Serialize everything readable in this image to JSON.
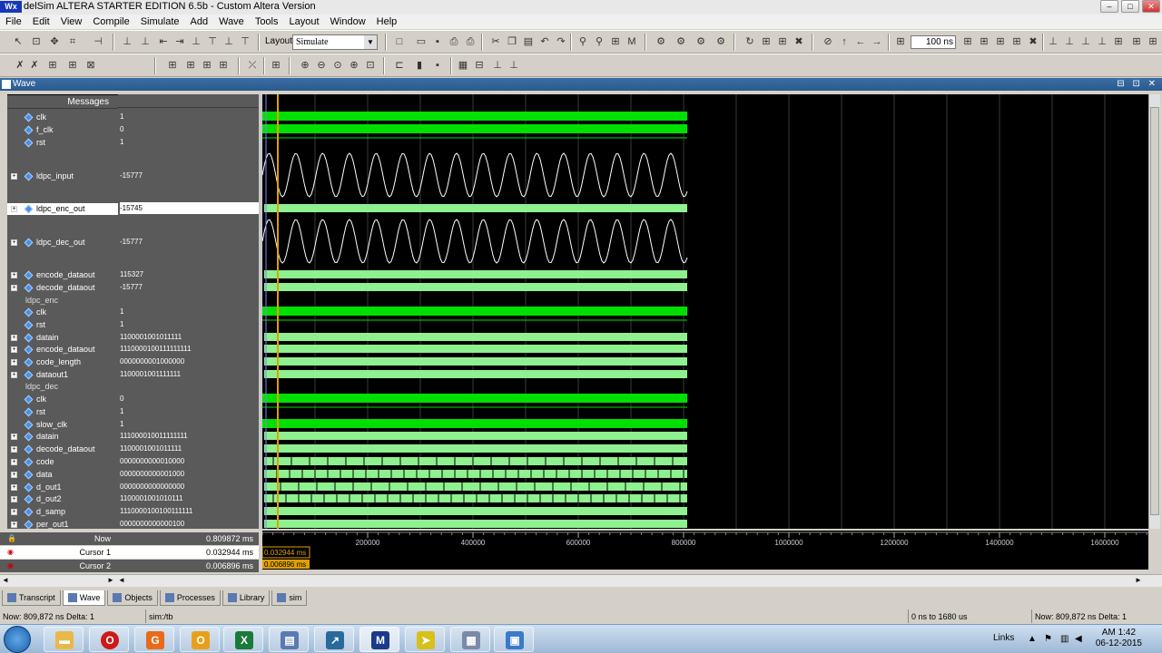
{
  "window": {
    "logo_text": "Wx",
    "title": "delSim ALTERA STARTER EDITION 6.5b - Custom Altera Version",
    "buttons": [
      "–",
      "□",
      "✕"
    ]
  },
  "menu": [
    "File",
    "Edit",
    "View",
    "Compile",
    "Simulate",
    "Add",
    "Wave",
    "Tools",
    "Layout",
    "Window",
    "Help"
  ],
  "toolbar": {
    "layout_label": "Layout",
    "layout_value": "Simulate",
    "run_length": "100 ns"
  },
  "wave_window": {
    "title": "Wave",
    "messages_header": "Messages"
  },
  "signals": [
    {
      "name": "clk",
      "value": "1",
      "expand": false,
      "type": "clock"
    },
    {
      "name": "f_clk",
      "value": "0",
      "expand": false,
      "type": "clock"
    },
    {
      "name": "rst",
      "value": "1",
      "expand": false,
      "type": "high"
    },
    {
      "name": "ldpc_input",
      "value": "-15777",
      "expand": true,
      "type": "sine"
    },
    {
      "name": "ldpc_enc_out",
      "value": "-15745",
      "expand": true,
      "type": "bus",
      "selected": true
    },
    {
      "name": "ldpc_dec_out",
      "value": "-15777",
      "expand": true,
      "type": "sine"
    },
    {
      "name": "encode_dataout",
      "value": "115327",
      "expand": true,
      "type": "bus"
    },
    {
      "name": "decode_dataout",
      "value": "-15777",
      "expand": true,
      "type": "bus"
    },
    {
      "name": "ldpc_enc",
      "value": "",
      "expand": false,
      "type": "group"
    },
    {
      "name": "clk",
      "value": "1",
      "expand": false,
      "type": "clock"
    },
    {
      "name": "rst",
      "value": "1",
      "expand": false,
      "type": "high"
    },
    {
      "name": "datain",
      "value": "1100001001011111",
      "expand": true,
      "type": "bus"
    },
    {
      "name": "encode_dataout",
      "value": "1110000100111111111",
      "expand": true,
      "type": "bus"
    },
    {
      "name": "code_length",
      "value": "0000000001000000",
      "expand": true,
      "type": "bus"
    },
    {
      "name": "dataout1",
      "value": "1100001001111111",
      "expand": true,
      "type": "bus"
    },
    {
      "name": "ldpc_dec",
      "value": "",
      "expand": false,
      "type": "group"
    },
    {
      "name": "clk",
      "value": "0",
      "expand": false,
      "type": "clock"
    },
    {
      "name": "rst",
      "value": "1",
      "expand": false,
      "type": "high"
    },
    {
      "name": "slow_clk",
      "value": "1",
      "expand": false,
      "type": "clock"
    },
    {
      "name": "datain",
      "value": "111000010011111111",
      "expand": true,
      "type": "bus"
    },
    {
      "name": "decode_dataout",
      "value": "1100001001011111",
      "expand": true,
      "type": "bus"
    },
    {
      "name": "code",
      "value": "0000000000010000",
      "expand": true,
      "type": "busticks"
    },
    {
      "name": "data",
      "value": "0000000000001000",
      "expand": true,
      "type": "busticks"
    },
    {
      "name": "d_out1",
      "value": "0000000000000000",
      "expand": true,
      "type": "busticks"
    },
    {
      "name": "d_out2",
      "value": "1100001001010111",
      "expand": true,
      "type": "busticks"
    },
    {
      "name": "d_samp",
      "value": "1110000100100111111",
      "expand": true,
      "type": "bus"
    },
    {
      "name": "per_out1",
      "value": "0000000000000100",
      "expand": true,
      "type": "bus"
    }
  ],
  "cursors": {
    "now_label": "Now",
    "now_value": "0.809872 ms",
    "cursor1_label": "Cursor 1",
    "cursor1_value": "0.032944 ms",
    "cursor1_flag": "0.032944 ms",
    "cursor2_label": "Cursor 2",
    "cursor2_value": "0.006896 ms",
    "cursor2_flag": "0.006896 ms"
  },
  "time_axis": {
    "ticks": [
      "200000",
      "400000",
      "600000",
      "800000",
      "1000000",
      "1200000",
      "1400000",
      "1600000"
    ]
  },
  "tabs": [
    "Transcript",
    "Wave",
    "Objects",
    "Processes",
    "Library",
    "sim"
  ],
  "status": {
    "now": "Now: 809,872 ns  Delta: 1",
    "context": "sim:/tb",
    "range": "0 ns to 1680 us",
    "now2": "Now: 809,872 ns  Delta: 1"
  },
  "taskbar": {
    "links": "Links",
    "time": "AM 1:42",
    "date": "06-12-2015"
  },
  "colors": {
    "wave_green": "#00e000",
    "bus_green": "#8ef08e",
    "cursor_orange": "#e0a000",
    "panel_gray": "#5a5a5a"
  }
}
